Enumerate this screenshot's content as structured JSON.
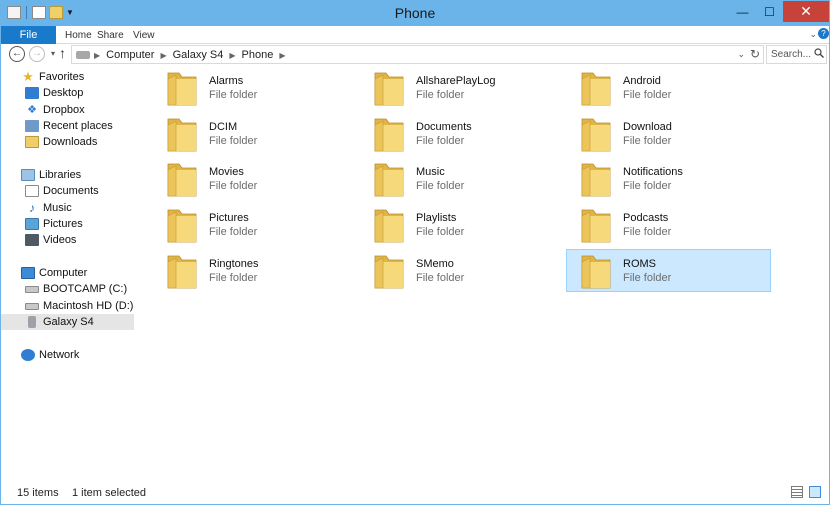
{
  "window": {
    "title": "Phone"
  },
  "title_controls": {
    "minimize": "—",
    "maximize": "☐",
    "close": "✕"
  },
  "ribbon": {
    "tabs": [
      "File",
      "Home",
      "Share",
      "View"
    ]
  },
  "navigation": {
    "back": "←",
    "forward": "→",
    "up": "↑",
    "breadcrumbs": [
      "Computer",
      "Galaxy S4",
      "Phone"
    ],
    "search_placeholder": "Search..."
  },
  "nav_pane": {
    "favorites": {
      "label": "Favorites",
      "items": [
        "Desktop",
        "Dropbox",
        "Recent places",
        "Downloads"
      ]
    },
    "libraries": {
      "label": "Libraries",
      "items": [
        "Documents",
        "Music",
        "Pictures",
        "Videos"
      ]
    },
    "computer": {
      "label": "Computer",
      "items": [
        "BOOTCAMP (C:)",
        "Macintosh HD (D:)",
        "Galaxy S4"
      ],
      "selected": "Galaxy S4"
    },
    "network": {
      "label": "Network"
    }
  },
  "files": [
    {
      "name": "Alarms",
      "type": "File folder"
    },
    {
      "name": "AllsharePlayLog",
      "type": "File folder"
    },
    {
      "name": "Android",
      "type": "File folder"
    },
    {
      "name": "DCIM",
      "type": "File folder"
    },
    {
      "name": "Documents",
      "type": "File folder"
    },
    {
      "name": "Download",
      "type": "File folder"
    },
    {
      "name": "Movies",
      "type": "File folder"
    },
    {
      "name": "Music",
      "type": "File folder"
    },
    {
      "name": "Notifications",
      "type": "File folder"
    },
    {
      "name": "Pictures",
      "type": "File folder"
    },
    {
      "name": "Playlists",
      "type": "File folder"
    },
    {
      "name": "Podcasts",
      "type": "File folder"
    },
    {
      "name": "Ringtones",
      "type": "File folder"
    },
    {
      "name": "SMemo",
      "type": "File folder"
    },
    {
      "name": "ROMS",
      "type": "File folder",
      "selected": true
    }
  ],
  "status": {
    "item_count": "15 items",
    "selection": "1 item selected"
  },
  "colors": {
    "titlebar": "#6ab4ea",
    "file_tab": "#1979ca",
    "selection": "#cce8ff",
    "selection_border": "#99d1ff",
    "close_button": "#c7433a",
    "folder": "#f0cf68"
  }
}
